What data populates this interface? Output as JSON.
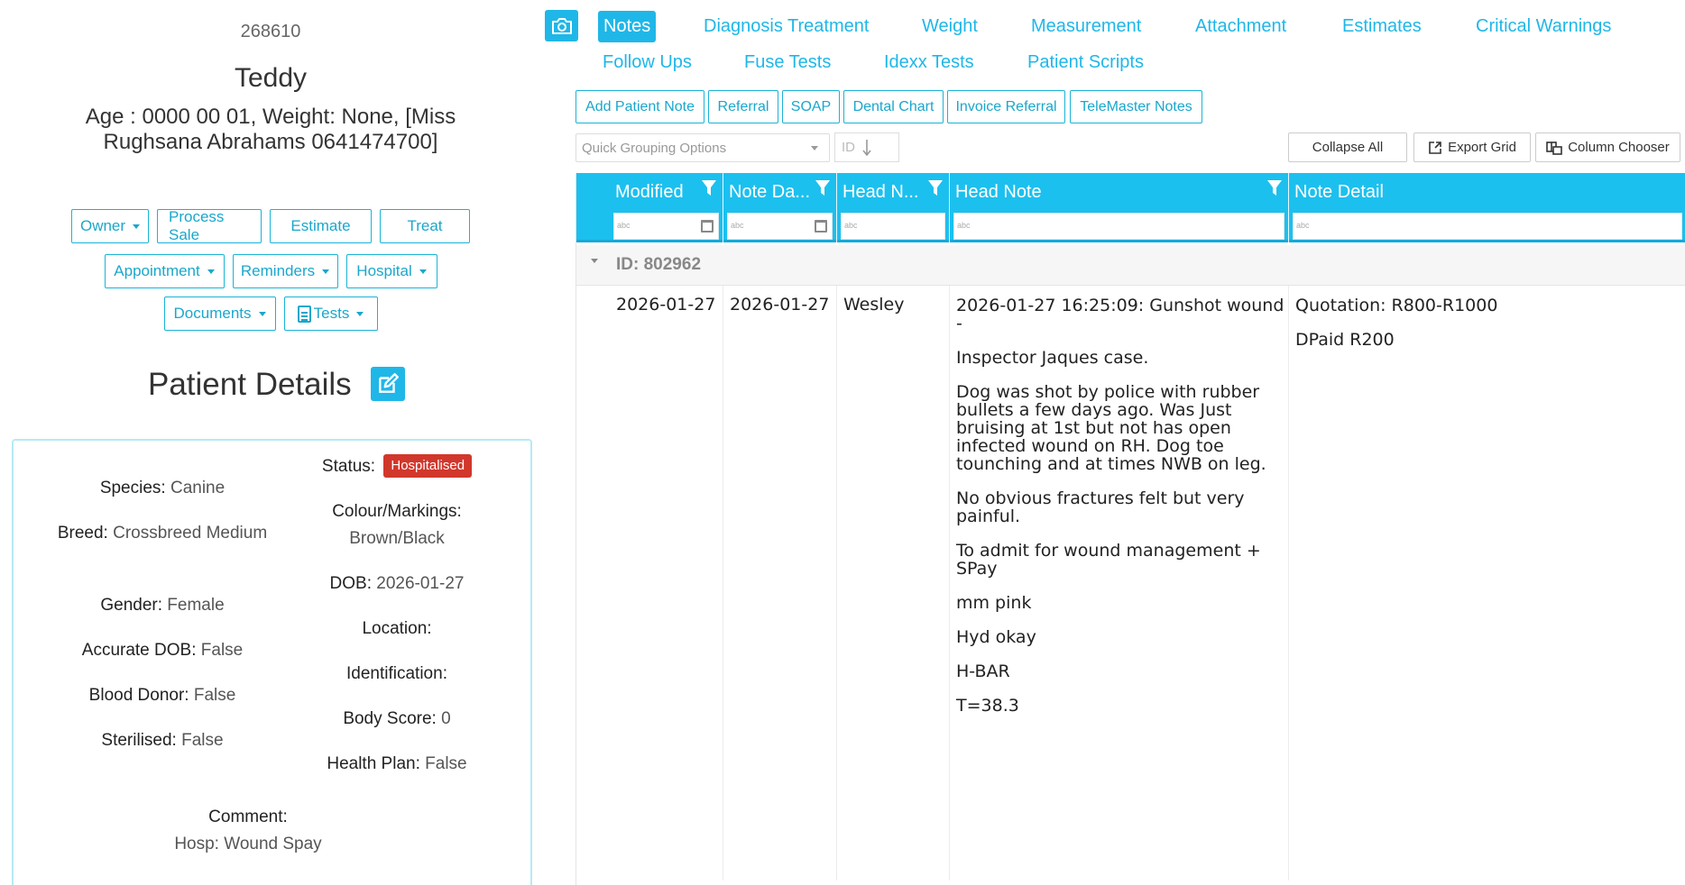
{
  "patient": {
    "id": "268610",
    "name": "Teddy",
    "info": "Age : 0000 00 01, Weight: None, [Miss Rughsana Abrahams 0641474700]"
  },
  "actions": {
    "row1": [
      "Owner",
      "Process Sale",
      "Estimate",
      "Treat"
    ],
    "row2": [
      "Appointment",
      "Reminders",
      "Hospital"
    ],
    "row3": [
      "Documents",
      "Tests"
    ]
  },
  "patient_details": {
    "title": "Patient Details",
    "species_label": "Species:",
    "species": "Canine",
    "breed_label": "Breed:",
    "breed": "Crossbreed Medium",
    "gender_label": "Gender:",
    "gender": "Female",
    "accurate_dob_label": "Accurate DOB:",
    "accurate_dob": "False",
    "blood_donor_label": "Blood Donor:",
    "blood_donor": "False",
    "sterilised_label": "Sterilised:",
    "sterilised": "False",
    "status_label": "Status:",
    "status": "Hospitalised",
    "colour_label": "Colour/Markings:",
    "colour": "Brown/Black",
    "dob_label": "DOB:",
    "dob": "2026-01-27",
    "location_label": "Location:",
    "identification_label": "Identification:",
    "body_score_label": "Body Score:",
    "body_score": "0",
    "health_plan_label": "Health Plan:",
    "health_plan": "False",
    "comment_label": "Comment:",
    "comment": "Hosp: Wound Spay"
  },
  "tabs": [
    "Notes",
    "Diagnosis Treatment",
    "Weight",
    "Measurement",
    "Attachment",
    "Estimates",
    "Critical Warnings",
    "Follow Ups",
    "Fuse Tests",
    "Idexx Tests",
    "Patient Scripts"
  ],
  "sub_buttons": [
    "Add Patient Note",
    "Referral",
    "SOAP",
    "Dental Chart",
    "Invoice Referral",
    "TeleMaster Notes"
  ],
  "toolbar": {
    "grouping_placeholder": "Quick Grouping Options",
    "sort_label": "ID",
    "collapse_all": "Collapse All",
    "export_grid": "Export Grid",
    "column_chooser": "Column Chooser"
  },
  "grid": {
    "columns": [
      "Modified",
      "Note Da...",
      "Head N...",
      "Head Note",
      "Note Detail"
    ],
    "filter_hint": "abc",
    "group_label": "ID: 802962",
    "row": {
      "modified": "2026-01-27",
      "note_date": "2026-01-27",
      "head_name": "Wesley",
      "head_note": [
        "2026-01-27 16:25:09: Gunshot wound -",
        "Inspector Jaques case.",
        "Dog was shot by police with rubber bullets a few days ago. Was Just bruising at 1st but not has open infected wound on RH. Dog toe tounching and at times NWB on leg.",
        "No obvious fractures felt but very painful.",
        "To admit for wound management + SPay",
        "mm pink",
        "Hyd okay",
        "H-BAR",
        "T=38.3"
      ],
      "note_detail": [
        "Quotation: R800-R1000",
        "DPaid R200"
      ]
    }
  },
  "colors": {
    "accent": "#1fb7e8",
    "header": "#1cc0ee",
    "status_badge": "#d2372c"
  }
}
